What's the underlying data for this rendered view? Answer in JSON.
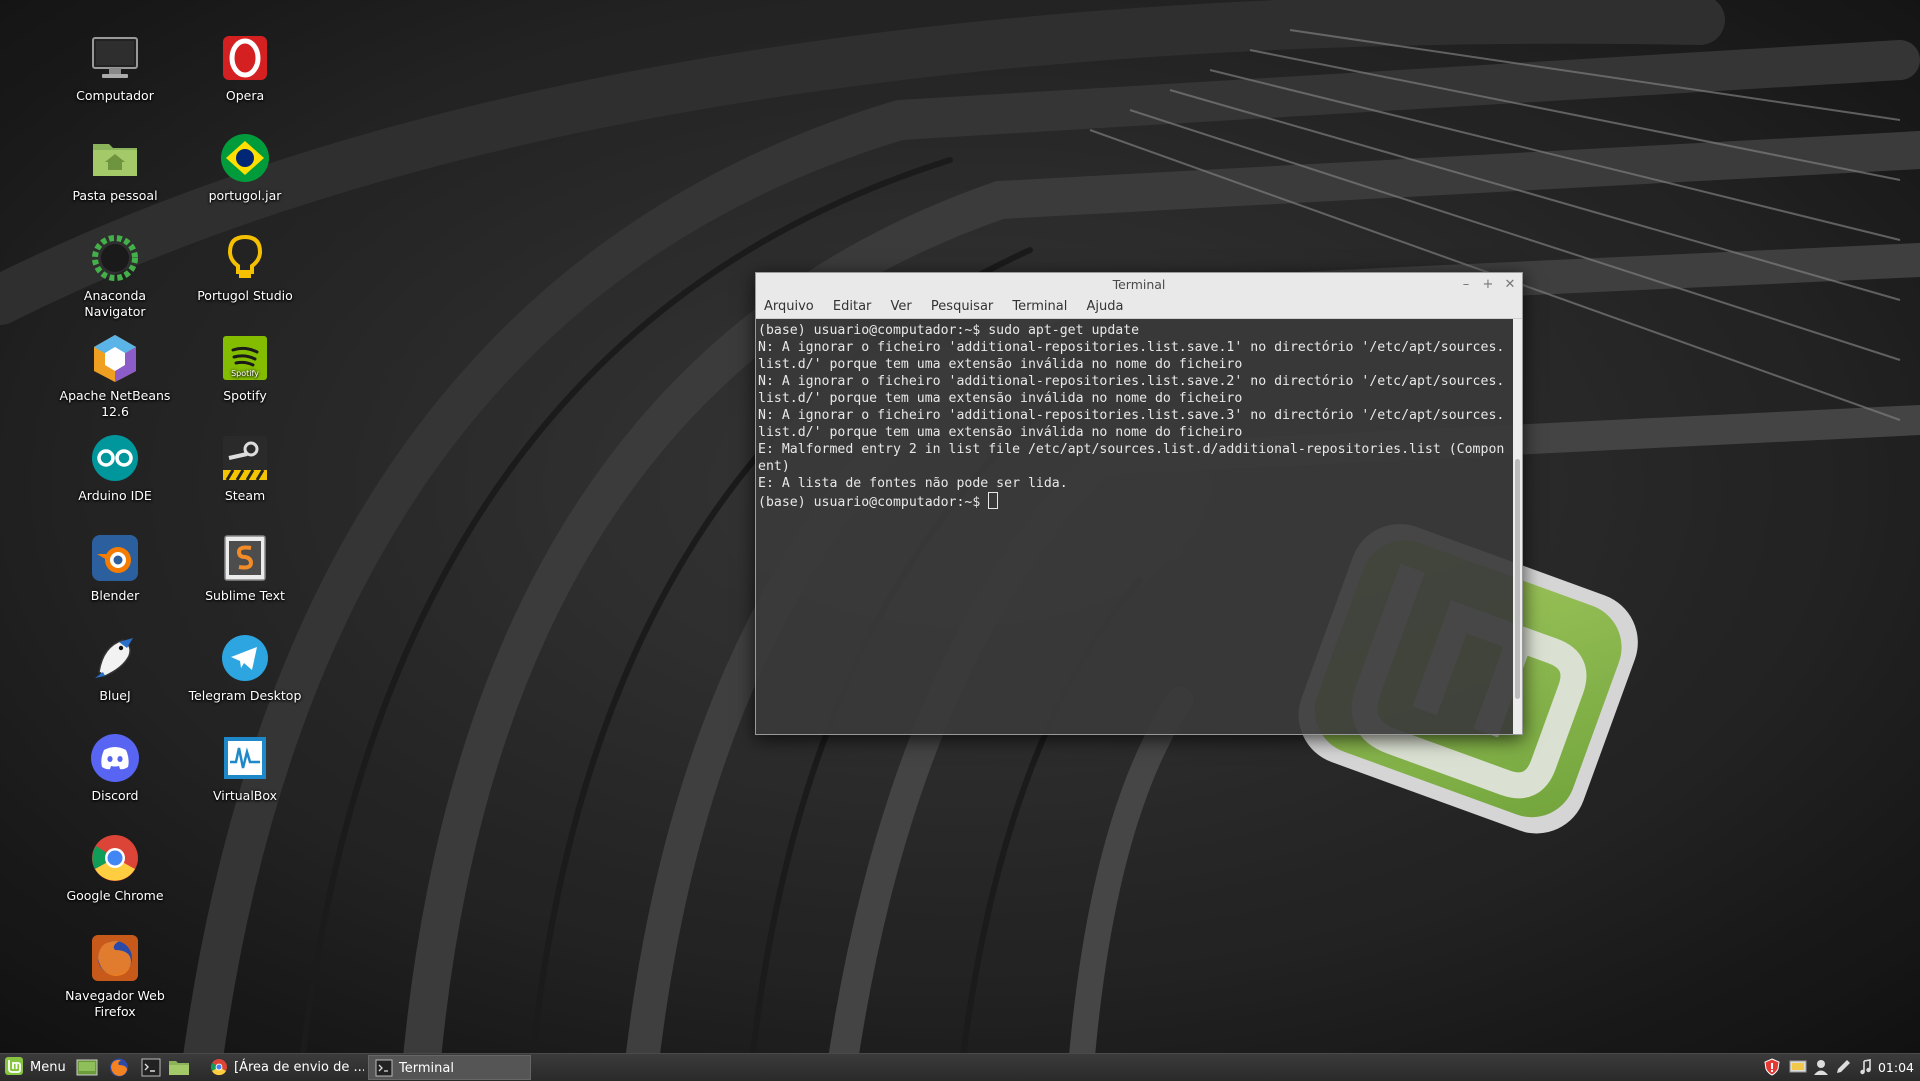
{
  "desktop": {
    "icons": [
      {
        "id": "computador",
        "label": "Computador",
        "icon": "monitor-icon"
      },
      {
        "id": "opera",
        "label": "Opera",
        "icon": "opera-icon"
      },
      {
        "id": "pasta",
        "label": "Pasta pessoal",
        "icon": "home-folder-icon"
      },
      {
        "id": "portugol-jar",
        "label": "portugol.jar",
        "icon": "brazil-flag-icon"
      },
      {
        "id": "anaconda",
        "label": "Anaconda\nNavigator",
        "icon": "anaconda-icon"
      },
      {
        "id": "portugol-studio",
        "label": "Portugol Studio",
        "icon": "lightbulb-icon"
      },
      {
        "id": "netbeans",
        "label": "Apache NetBeans\n12.6",
        "icon": "netbeans-icon"
      },
      {
        "id": "spotify",
        "label": "Spotify",
        "icon": "spotify-icon"
      },
      {
        "id": "arduino",
        "label": "Arduino IDE",
        "icon": "arduino-icon"
      },
      {
        "id": "steam",
        "label": "Steam",
        "icon": "steam-icon"
      },
      {
        "id": "blender",
        "label": "Blender",
        "icon": "blender-icon"
      },
      {
        "id": "sublime",
        "label": "Sublime Text",
        "icon": "sublime-icon"
      },
      {
        "id": "bluej",
        "label": "BlueJ",
        "icon": "bluej-icon"
      },
      {
        "id": "telegram",
        "label": "Telegram Desktop",
        "icon": "telegram-icon"
      },
      {
        "id": "discord",
        "label": "Discord",
        "icon": "discord-icon"
      },
      {
        "id": "virtualbox",
        "label": "VirtualBox",
        "icon": "virtualbox-icon"
      },
      {
        "id": "chrome",
        "label": "Google Chrome",
        "icon": "chrome-icon"
      },
      {
        "id": "firefox",
        "label": "Navegador Web\nFirefox",
        "icon": "firefox-icon"
      }
    ],
    "spotify_badge": "Spotify"
  },
  "terminal": {
    "title": "Terminal",
    "menu": [
      "Arquivo",
      "Editar",
      "Ver",
      "Pesquisar",
      "Terminal",
      "Ajuda"
    ],
    "lines": [
      "(base) usuario@computador:~$ sudo apt-get update",
      "N: A ignorar o ficheiro 'additional-repositories.list.save.1' no directório '/etc/apt/sources.",
      "list.d/' porque tem uma extensão inválida no nome do ficheiro",
      "N: A ignorar o ficheiro 'additional-repositories.list.save.2' no directório '/etc/apt/sources.",
      "list.d/' porque tem uma extensão inválida no nome do ficheiro",
      "N: A ignorar o ficheiro 'additional-repositories.list.save.3' no directório '/etc/apt/sources.",
      "list.d/' porque tem uma extensão inválida no nome do ficheiro",
      "E: Malformed entry 2 in list file /etc/apt/sources.list.d/additional-repositories.list (Compon",
      "ent)",
      "E: A lista de fontes não pode ser lida."
    ],
    "prompt": "(base) usuario@computador:~$ ",
    "buttons": {
      "minimize": "–",
      "maximize": "+",
      "close": "✕"
    }
  },
  "taskbar": {
    "menu_label": "Menu",
    "tasks": [
      {
        "label": "[Área de envio de ...",
        "icon": "chrome-icon"
      },
      {
        "label": "Terminal",
        "icon": "terminal-icon"
      }
    ],
    "clock": "01:04"
  }
}
